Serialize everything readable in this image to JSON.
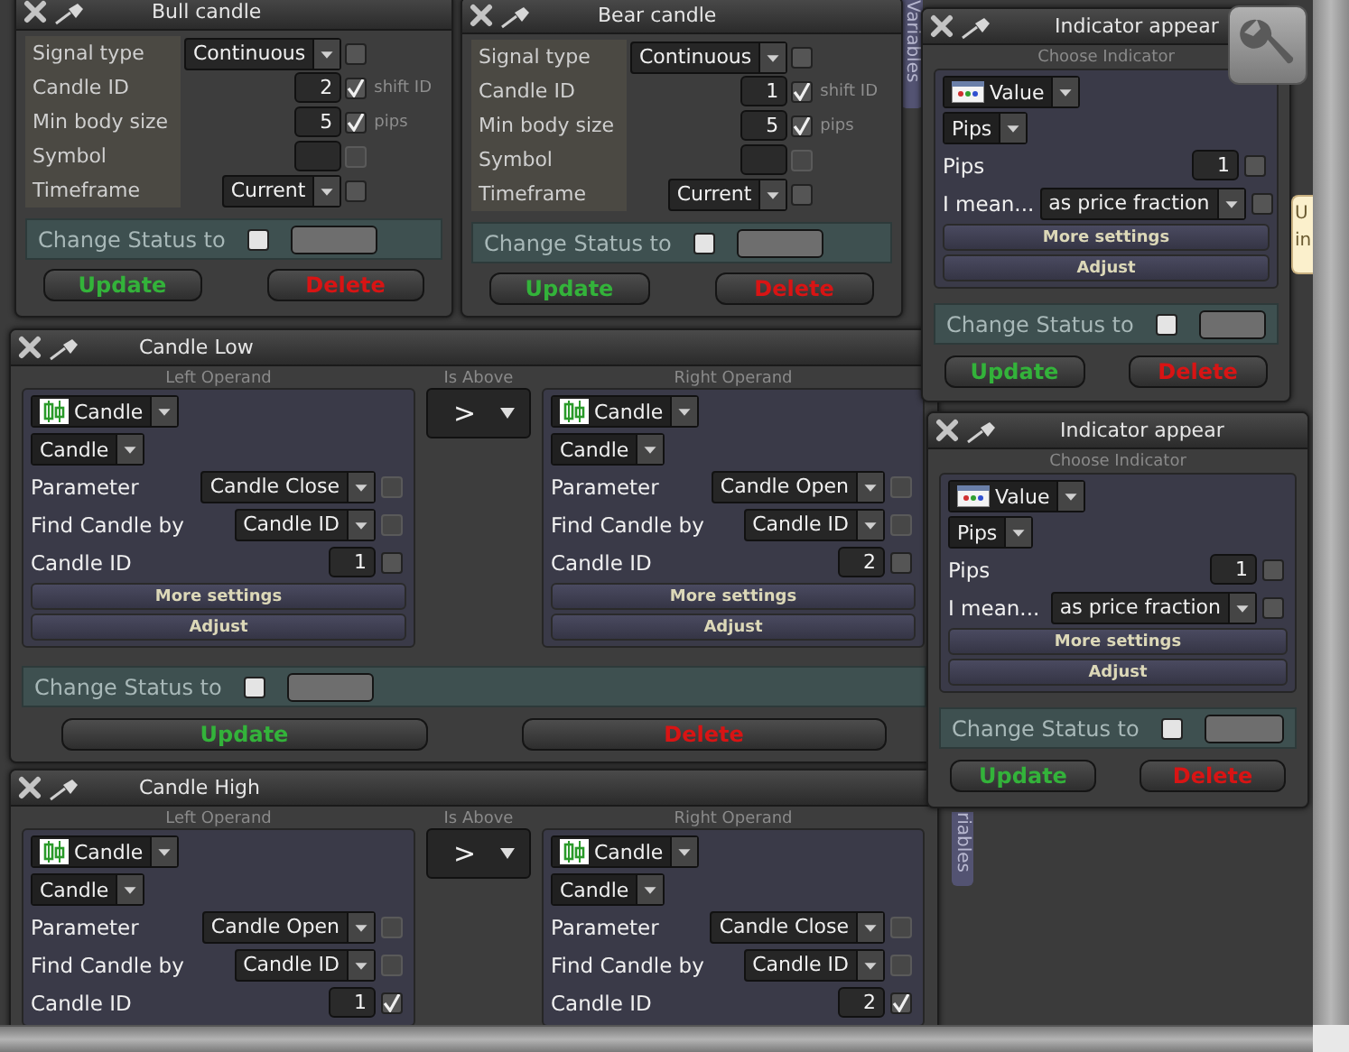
{
  "variables_tabs": [
    {
      "label": "Variables"
    },
    {
      "label": "riables"
    }
  ],
  "signal_panels": [
    {
      "title": "Bull candle",
      "rows": [
        {
          "kind": "select",
          "label": "Signal type",
          "value": "Continuous",
          "checked": false,
          "disabled": false
        },
        {
          "kind": "number",
          "label": "Candle ID",
          "value": "2",
          "checked": true,
          "disabled": false,
          "suffix": "shift ID"
        },
        {
          "kind": "number",
          "label": "Min body size",
          "value": "5",
          "checked": true,
          "disabled": false,
          "suffix": "pips"
        },
        {
          "kind": "text",
          "label": "Symbol",
          "checked": false,
          "disabled": true
        },
        {
          "kind": "select",
          "label": "Timeframe",
          "value": "Current",
          "checked": false,
          "disabled": false
        }
      ],
      "status": {
        "label": "Change Status to",
        "checked": false
      },
      "buttons": [
        {
          "label": "Update",
          "kind": "update"
        },
        {
          "label": "Delete",
          "kind": "delete"
        }
      ]
    },
    {
      "title": "Bear candle",
      "rows": [
        {
          "kind": "select",
          "label": "Signal type",
          "value": "Continuous",
          "checked": false,
          "disabled": false
        },
        {
          "kind": "number",
          "label": "Candle ID",
          "value": "1",
          "checked": true,
          "disabled": false,
          "suffix": "shift ID"
        },
        {
          "kind": "number",
          "label": "Min body size",
          "value": "5",
          "checked": true,
          "disabled": false,
          "suffix": "pips"
        },
        {
          "kind": "text",
          "label": "Symbol",
          "checked": false,
          "disabled": true
        },
        {
          "kind": "select",
          "label": "Timeframe",
          "value": "Current",
          "checked": false,
          "disabled": false
        }
      ],
      "status": {
        "label": "Change Status to",
        "checked": false
      },
      "buttons": [
        {
          "label": "Update",
          "kind": "update"
        },
        {
          "label": "Delete",
          "kind": "delete"
        }
      ]
    }
  ],
  "condition_panels": [
    {
      "title": "Candle Low",
      "operands": [
        {
          "heading": "Left Operand",
          "source": "Candle",
          "type": "Candle",
          "rows": [
            {
              "kind": "select",
              "label": "Parameter",
              "value": "Candle Close",
              "checked": false,
              "disabled": true
            },
            {
              "kind": "select",
              "label": "Find Candle by",
              "value": "Candle ID",
              "checked": false,
              "disabled": true
            },
            {
              "kind": "number",
              "label": "Candle ID",
              "value": "1",
              "checked": false,
              "disabled": false
            }
          ],
          "more_settings": "More settings",
          "adjust": "Adjust"
        },
        {
          "heading": "Right Operand",
          "source": "Candle",
          "type": "Candle",
          "rows": [
            {
              "kind": "select",
              "label": "Parameter",
              "value": "Candle Open",
              "checked": false,
              "disabled": true
            },
            {
              "kind": "select",
              "label": "Find Candle by",
              "value": "Candle ID",
              "checked": false,
              "disabled": true
            },
            {
              "kind": "number",
              "label": "Candle ID",
              "value": "2",
              "checked": false,
              "disabled": false
            }
          ],
          "more_settings": "More settings",
          "adjust": "Adjust"
        }
      ],
      "operator": {
        "heading": "Is Above",
        "symbol": ">"
      },
      "status": {
        "label": "Change Status to",
        "checked": false
      },
      "buttons": [
        {
          "label": "Update",
          "kind": "update"
        },
        {
          "label": "Delete",
          "kind": "delete"
        }
      ]
    },
    {
      "title": "Candle High",
      "operands": [
        {
          "heading": "Left Operand",
          "source": "Candle",
          "type": "Candle",
          "rows": [
            {
              "kind": "select",
              "label": "Parameter",
              "value": "Candle Open",
              "checked": false,
              "disabled": true
            },
            {
              "kind": "select",
              "label": "Find Candle by",
              "value": "Candle ID",
              "checked": false,
              "disabled": true
            },
            {
              "kind": "number",
              "label": "Candle ID",
              "value": "1",
              "checked": true,
              "disabled": false
            }
          ]
        },
        {
          "heading": "Right Operand",
          "source": "Candle",
          "type": "Candle",
          "rows": [
            {
              "kind": "select",
              "label": "Parameter",
              "value": "Candle Close",
              "checked": false,
              "disabled": true
            },
            {
              "kind": "select",
              "label": "Find Candle by",
              "value": "Candle ID",
              "checked": false,
              "disabled": true
            },
            {
              "kind": "number",
              "label": "Candle ID",
              "value": "2",
              "checked": true,
              "disabled": false
            }
          ]
        }
      ],
      "operator": {
        "heading": "Is Above",
        "symbol": ">"
      }
    }
  ],
  "indicator_panels": [
    {
      "title": "Indicator appear",
      "heading": "Choose Indicator",
      "indicator": "Value",
      "unit": "Pips",
      "rows": [
        {
          "kind": "number",
          "label": "Pips",
          "value": "1",
          "checked": false,
          "disabled": false
        },
        {
          "kind": "select",
          "label": "I mean...",
          "value": "as price fraction",
          "checked": false,
          "disabled": false
        }
      ],
      "more_settings": "More settings",
      "adjust": "Adjust",
      "status": {
        "label": "Change Status to",
        "checked": false
      },
      "buttons": [
        {
          "label": "Update",
          "kind": "update"
        },
        {
          "label": "Delete",
          "kind": "delete"
        }
      ]
    },
    {
      "title": "Indicator appear",
      "heading": "Choose Indicator",
      "indicator": "Value",
      "unit": "Pips",
      "rows": [
        {
          "kind": "number",
          "label": "Pips",
          "value": "1",
          "checked": false,
          "disabled": false
        },
        {
          "kind": "select",
          "label": "I mean...",
          "value": "as price fraction",
          "checked": false,
          "disabled": false
        }
      ],
      "more_settings": "More settings",
      "adjust": "Adjust",
      "status": {
        "label": "Change Status to",
        "checked": false
      },
      "buttons": [
        {
          "label": "Update",
          "kind": "update"
        },
        {
          "label": "Delete",
          "kind": "delete"
        }
      ]
    }
  ],
  "tooltip": {
    "lines": [
      "U",
      "in"
    ]
  }
}
